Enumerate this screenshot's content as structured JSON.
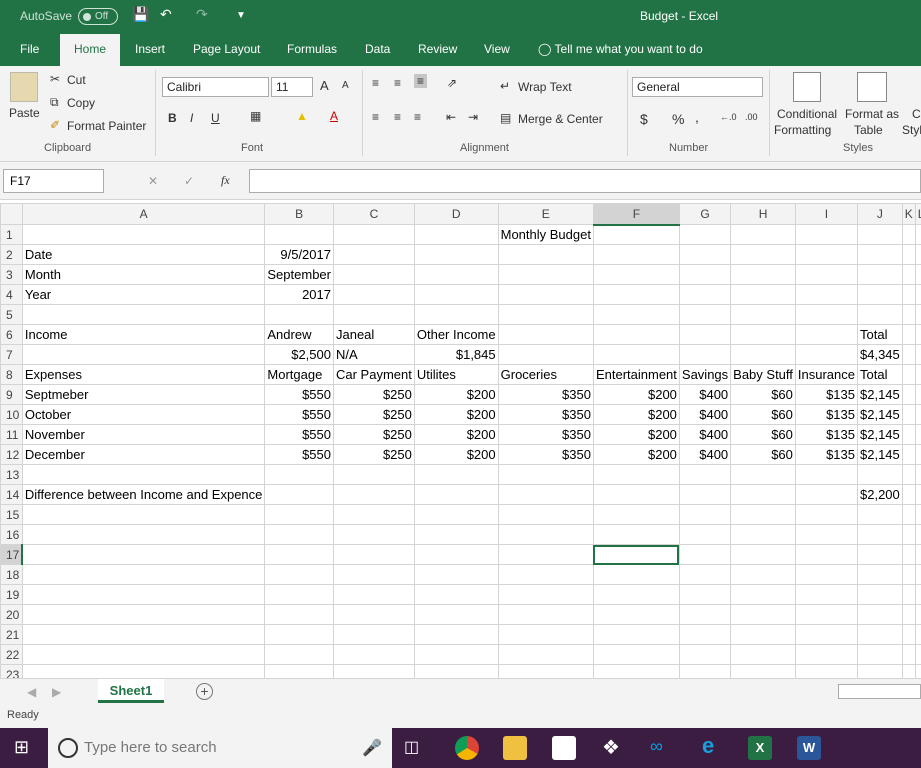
{
  "titlebar": {
    "autosave": "AutoSave",
    "toggle": "Off",
    "title": "Budget  -  Excel"
  },
  "tabs": [
    "File",
    "Home",
    "Insert",
    "Page Layout",
    "Formulas",
    "Data",
    "Review",
    "View"
  ],
  "tellme": "Tell me what you want to do",
  "ribbon": {
    "paste": "Paste",
    "cut": "Cut",
    "copy": "Copy",
    "format_painter": "Format Painter",
    "clipboard": "Clipboard",
    "font_name": "Calibri",
    "font_size": "11",
    "font": "Font",
    "wrap_text": "Wrap Text",
    "merge_center": "Merge & Center",
    "alignment": "Alignment",
    "number_format": "General",
    "number": "Number",
    "conditional": "Conditional",
    "formatting": "Formatting",
    "format_as": "Format as",
    "table": "Table",
    "styles": "Styles",
    "cell_styles_cut": "C",
    "styl_cut": "Styl"
  },
  "formula": {
    "namebox": "F17",
    "fx": "fx",
    "content": ""
  },
  "columns": [
    "A",
    "B",
    "C",
    "D",
    "E",
    "F",
    "G",
    "H",
    "I",
    "J",
    "K",
    "L"
  ],
  "rows": [
    [
      "",
      "",
      "",
      "",
      "Monthly Budget",
      "",
      "",
      "",
      "",
      "",
      "",
      ""
    ],
    [
      "Date",
      "9/5/2017",
      "",
      "",
      "",
      "",
      "",
      "",
      "",
      "",
      "",
      ""
    ],
    [
      "Month",
      "September",
      "",
      "",
      "",
      "",
      "",
      "",
      "",
      "",
      "",
      ""
    ],
    [
      "Year",
      "2017",
      "",
      "",
      "",
      "",
      "",
      "",
      "",
      "",
      "",
      ""
    ],
    [
      "",
      "",
      "",
      "",
      "",
      "",
      "",
      "",
      "",
      "",
      "",
      ""
    ],
    [
      "Income",
      "Andrew",
      "Janeal",
      "Other Income",
      "",
      "",
      "",
      "",
      "",
      "Total",
      "",
      ""
    ],
    [
      "",
      "$2,500",
      "N/A",
      "$1,845",
      "",
      "",
      "",
      "",
      "",
      "$4,345",
      "",
      ""
    ],
    [
      "Expenses",
      "Mortgage",
      "Car Payment",
      "Utilites",
      "Groceries",
      "Entertainment",
      "Savings",
      "Baby Stuff",
      "Insurance",
      "Total",
      "",
      ""
    ],
    [
      "Septmeber",
      "$550",
      "$250",
      "$200",
      "$350",
      "$200",
      "$400",
      "$60",
      "$135",
      "$2,145",
      "",
      ""
    ],
    [
      "October",
      "$550",
      "$250",
      "$200",
      "$350",
      "$200",
      "$400",
      "$60",
      "$135",
      "$2,145",
      "",
      ""
    ],
    [
      "November",
      "$550",
      "$250",
      "$200",
      "$350",
      "$200",
      "$400",
      "$60",
      "$135",
      "$2,145",
      "",
      ""
    ],
    [
      "December",
      "$550",
      "$250",
      "$200",
      "$350",
      "$200",
      "$400",
      "$60",
      "$135",
      "$2,145",
      "",
      ""
    ],
    [
      "",
      "",
      "",
      "",
      "",
      "",
      "",
      "",
      "",
      "",
      "",
      ""
    ],
    [
      "Difference between Income and Expence",
      "",
      "",
      "",
      "",
      "",
      "",
      "",
      "",
      "$2,200",
      "",
      ""
    ],
    [
      "",
      "",
      "",
      "",
      "",
      "",
      "",
      "",
      "",
      "",
      "",
      ""
    ],
    [
      "",
      "",
      "",
      "",
      "",
      "",
      "",
      "",
      "",
      "",
      "",
      ""
    ],
    [
      "",
      "",
      "",
      "",
      "",
      "",
      "",
      "",
      "",
      "",
      "",
      ""
    ],
    [
      "",
      "",
      "",
      "",
      "",
      "",
      "",
      "",
      "",
      "",
      "",
      ""
    ],
    [
      "",
      "",
      "",
      "",
      "",
      "",
      "",
      "",
      "",
      "",
      "",
      ""
    ],
    [
      "",
      "",
      "",
      "",
      "",
      "",
      "",
      "",
      "",
      "",
      "",
      ""
    ],
    [
      "",
      "",
      "",
      "",
      "",
      "",
      "",
      "",
      "",
      "",
      "",
      ""
    ],
    [
      "",
      "",
      "",
      "",
      "",
      "",
      "",
      "",
      "",
      "",
      "",
      ""
    ],
    [
      "",
      "",
      "",
      "",
      "",
      "",
      "",
      "",
      "",
      "",
      "",
      ""
    ]
  ],
  "sheet": {
    "tab": "Sheet1",
    "add": "+"
  },
  "status": "Ready",
  "taskbar": {
    "search_placeholder": "Type here to search"
  },
  "colors": {
    "excel_green": "#217346",
    "taskbar": "#3b1d42"
  }
}
